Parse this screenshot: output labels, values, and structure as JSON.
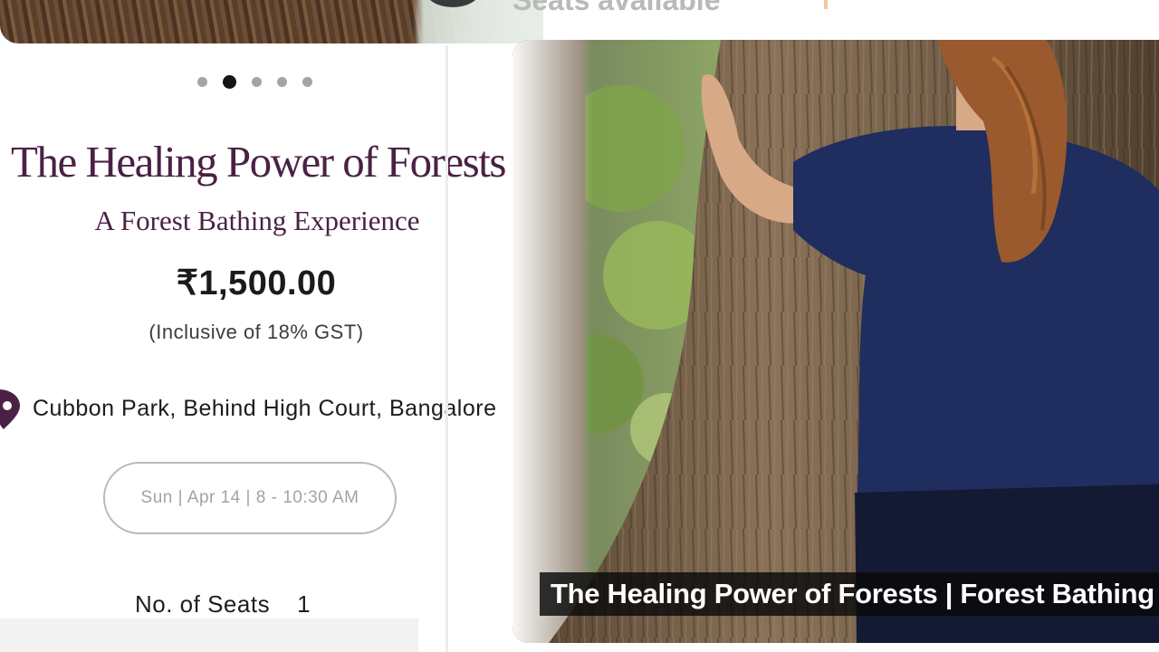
{
  "header": {
    "seats_banner": "Seats available"
  },
  "carousel": {
    "dot_count": 5,
    "active_index": 1
  },
  "event": {
    "title": "The Healing Power of Forests",
    "subtitle": "A Forest Bathing Experience",
    "price": "₹1,500.00",
    "tax_note": "(Inclusive of 18% GST)",
    "location": "Cubbon Park, Behind High Court, Bangalore",
    "schedule": "Sun | Apr 14 | 8 - 10:30 AM",
    "seats_label": "No. of Seats",
    "seats_value": "1"
  },
  "video": {
    "caption": "The Healing Power of Forests | Forest Bathing W"
  },
  "colors": {
    "title": "#4a2144",
    "pin": "#4a2144",
    "text": "#1b1b1b",
    "muted": "#a3a3a3"
  },
  "icons": {
    "location": "location-pin-icon"
  }
}
